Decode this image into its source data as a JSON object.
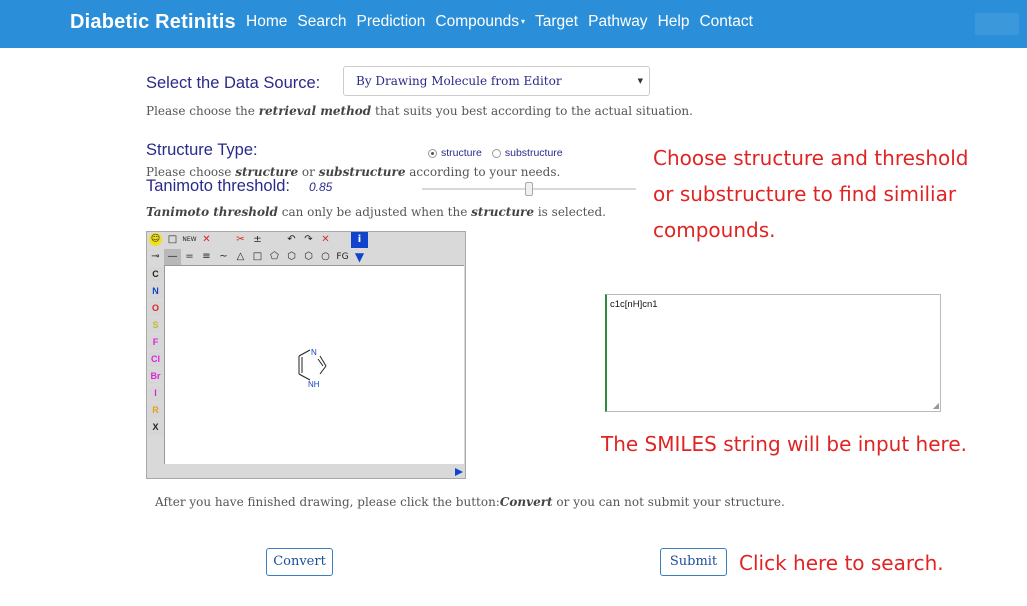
{
  "navbar": {
    "brand": "Diabetic Retinitis",
    "items": [
      "Home",
      "Search",
      "Prediction",
      "Compounds",
      "Target",
      "Pathway",
      "Help",
      "Contact"
    ]
  },
  "data_source": {
    "heading": "Select the Data Source:",
    "selected": "By Drawing Molecule from Editor",
    "help_pre": "Please choose the ",
    "help_bold": "retrieval method",
    "help_post": " that suits you best according to the actual situation."
  },
  "structure_type": {
    "heading": "Structure Type:",
    "options": [
      "structure",
      "substructure"
    ],
    "selected": "structure",
    "help_pre": "Please choose ",
    "help_b1": "structure",
    "help_mid": " or ",
    "help_b2": "substructure",
    "help_post": " according to your needs."
  },
  "threshold": {
    "heading": "Tanimoto threshold:",
    "value": "0.85",
    "fraction": 0.85,
    "help_b1": "Tanimoto threshold",
    "help_mid": " can only be adjusted when the ",
    "help_b2": "structure",
    "help_post": " is selected."
  },
  "editor": {
    "toolbar_row1": [
      "☺",
      "□",
      "NEW",
      "✕",
      "",
      "✂",
      "±",
      "",
      "↶",
      "↷",
      "✕",
      "",
      "i"
    ],
    "toolbar_row2": [
      "⊸",
      "—",
      "=",
      "≡",
      "~",
      "△",
      "□",
      "⬠",
      "⬡",
      "⬡",
      "○",
      "FG",
      "▼"
    ],
    "atoms": [
      "C",
      "N",
      "O",
      "S",
      "F",
      "Cl",
      "Br",
      "I",
      "R",
      "X"
    ],
    "atom_colors": [
      "#222222",
      "#1144cc",
      "#dd2222",
      "#c8b830",
      "#dd22dd",
      "#dd22dd",
      "#dd22dd",
      "#dd22dd",
      "#e0a020",
      "#222222"
    ],
    "molecule_label_n": "N",
    "molecule_label_nh": "NH"
  },
  "after_help": {
    "pre": "After you have finished drawing, please click the button:",
    "bold": "Convert",
    "post": " or you can not submit your structure."
  },
  "smiles": {
    "value": "c1c[nH]cn1"
  },
  "annotations": {
    "structure_note": [
      "Choose structure and threshold",
      "or substructure to find similiar",
      "compounds."
    ],
    "smiles_note": "The SMILES string will be input here.",
    "search_note": "Click here to search."
  },
  "buttons": {
    "convert": "Convert",
    "submit": "Submit"
  }
}
